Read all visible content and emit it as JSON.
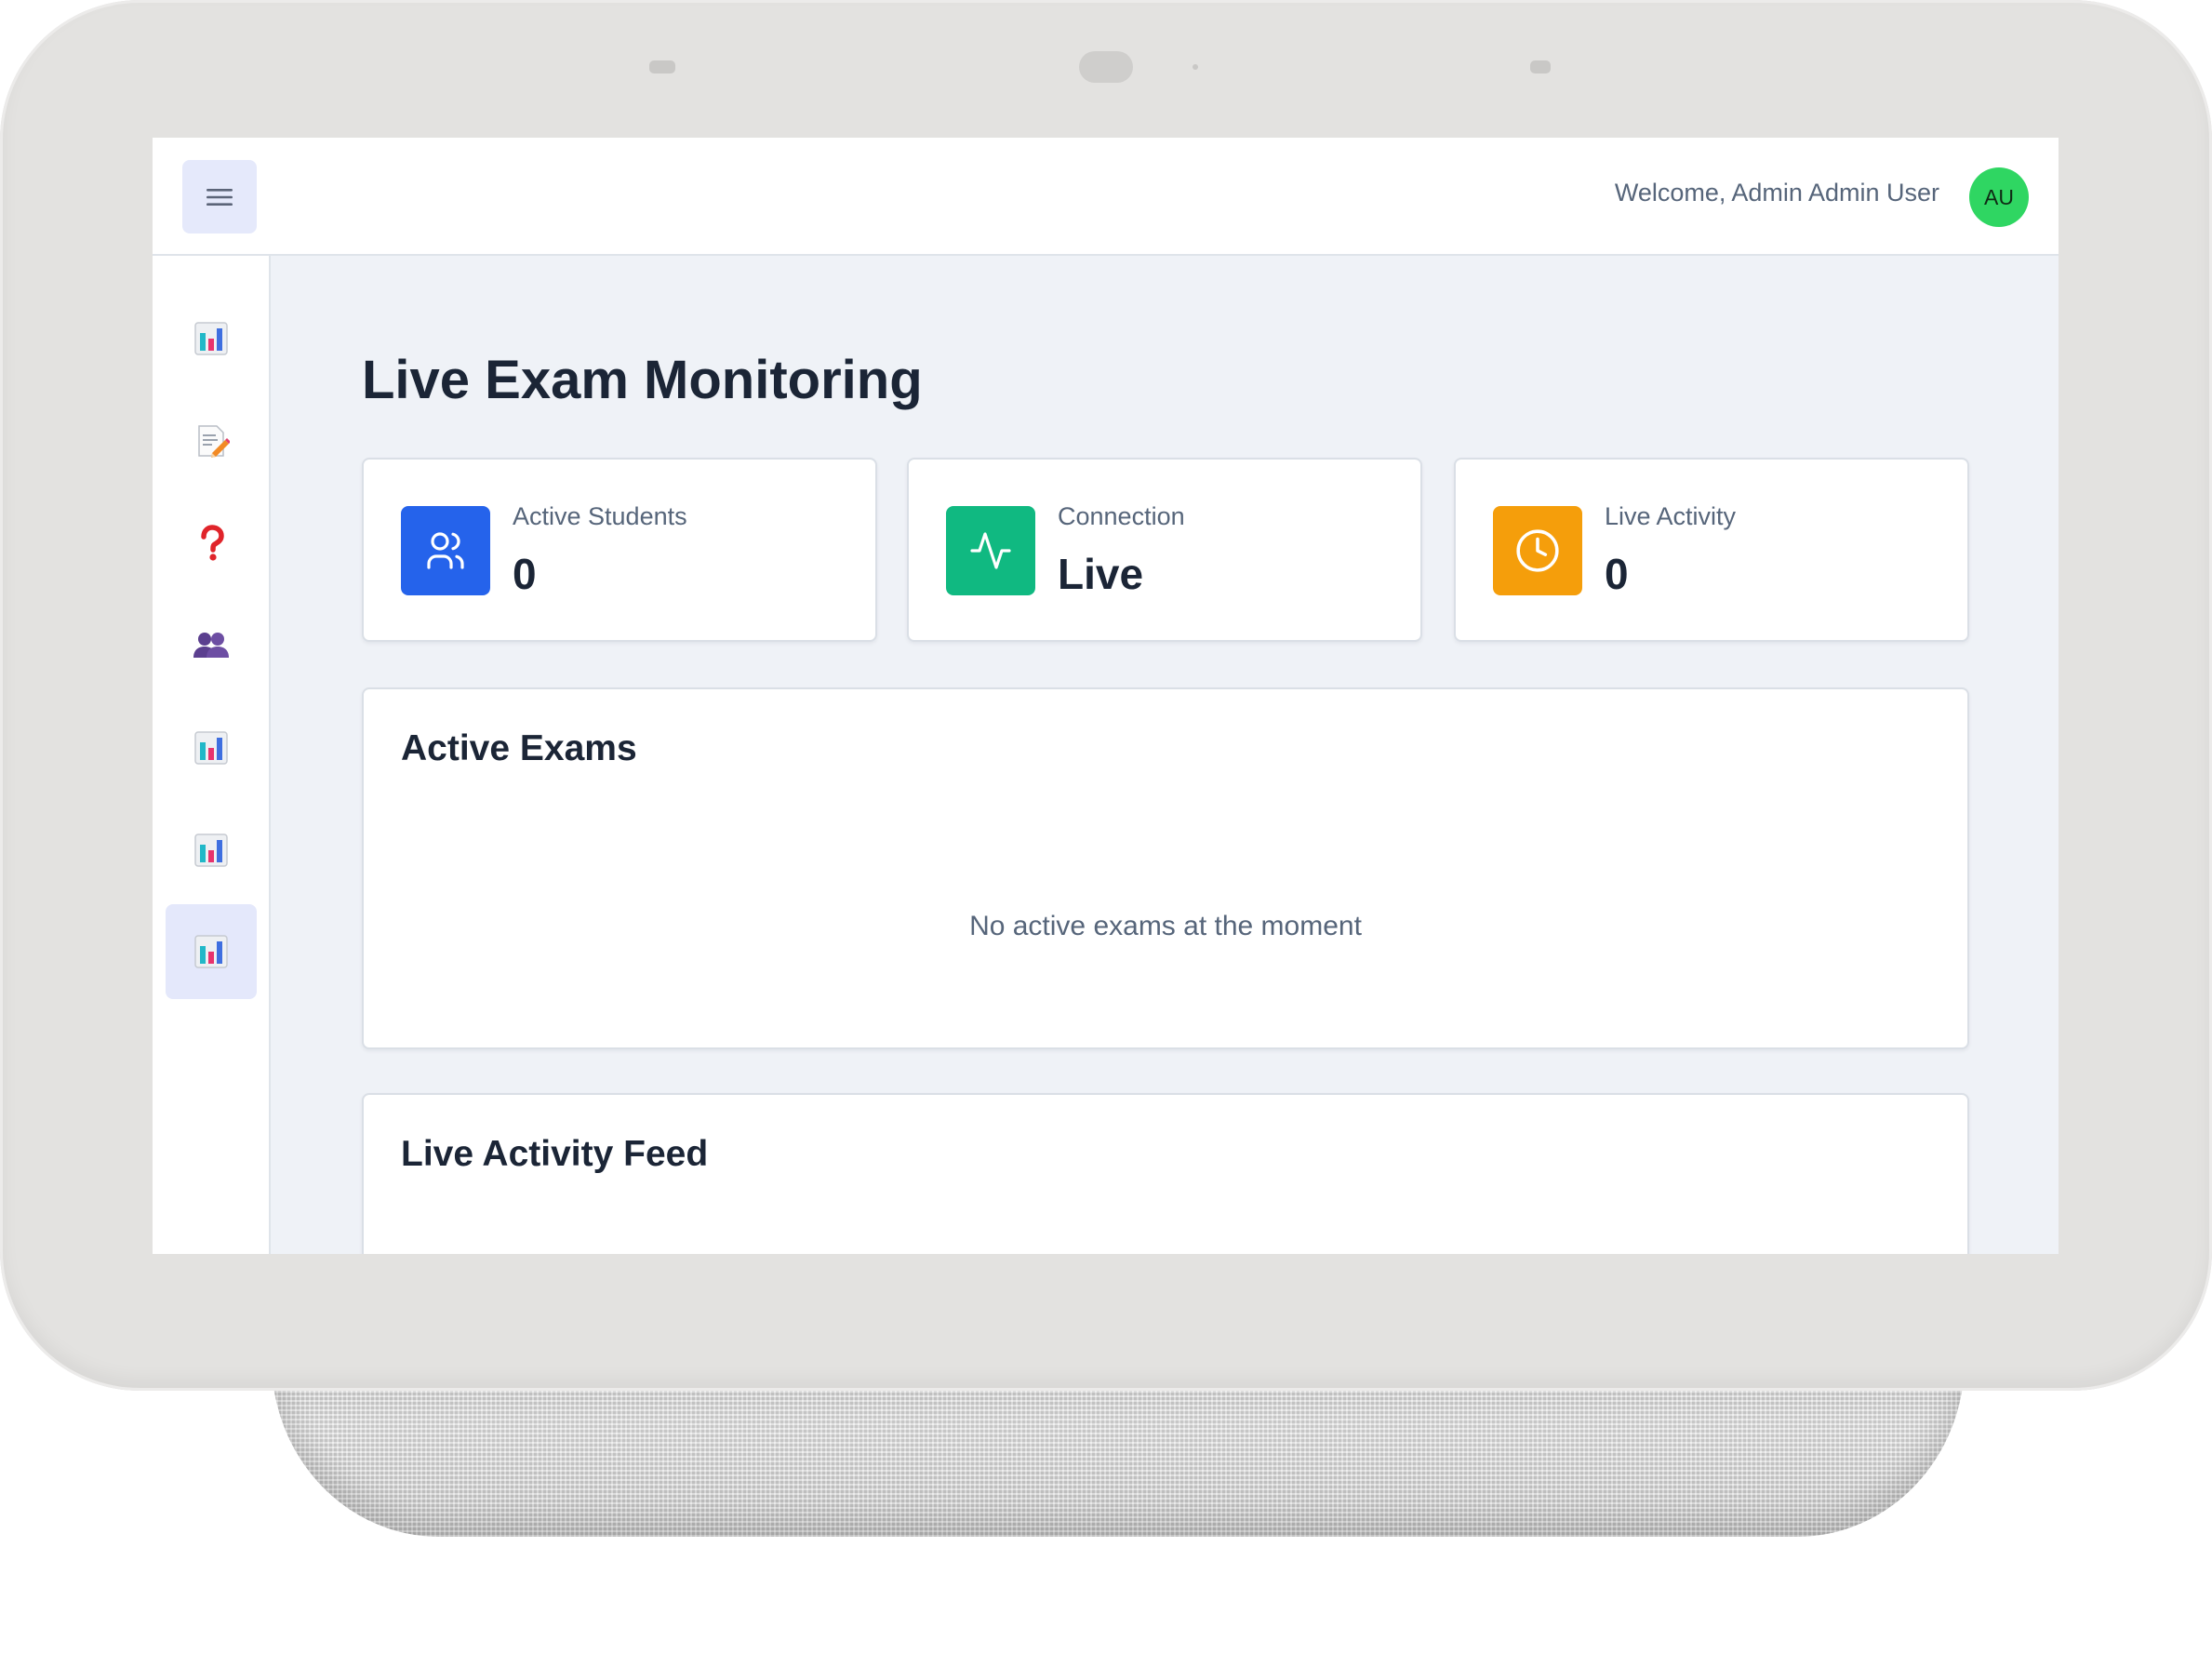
{
  "header": {
    "menu_icon": "hamburger-icon",
    "welcome_text": "Welcome, Admin Admin User",
    "avatar_initials": "AU",
    "avatar_color": "#2fd662"
  },
  "sidebar": {
    "items": [
      {
        "icon": "bar-chart-icon",
        "active": false
      },
      {
        "icon": "memo-pencil-icon",
        "active": false
      },
      {
        "icon": "question-mark-icon",
        "active": false
      },
      {
        "icon": "users-icon",
        "active": false
      },
      {
        "icon": "bar-chart-icon",
        "active": false
      },
      {
        "icon": "bar-chart-icon",
        "active": false
      },
      {
        "icon": "bar-chart-icon",
        "active": true
      }
    ]
  },
  "page": {
    "title": "Live Exam Monitoring"
  },
  "stats": [
    {
      "label": "Active Students",
      "value": "0",
      "icon": "users-icon",
      "color": "#2563eb"
    },
    {
      "label": "Connection",
      "value": "Live",
      "icon": "activity-icon",
      "color": "#10b981"
    },
    {
      "label": "Live Activity",
      "value": "0",
      "icon": "clock-icon",
      "color": "#f59e0b"
    }
  ],
  "active_exams": {
    "title": "Active Exams",
    "empty_message": "No active exams at the moment"
  },
  "activity_feed": {
    "title": "Live Activity Feed"
  },
  "colors": {
    "main_background": "#eff2f7",
    "active_nav_background": "#e4e8fb",
    "text_dark": "#1b2536",
    "text_muted": "#56657a"
  }
}
